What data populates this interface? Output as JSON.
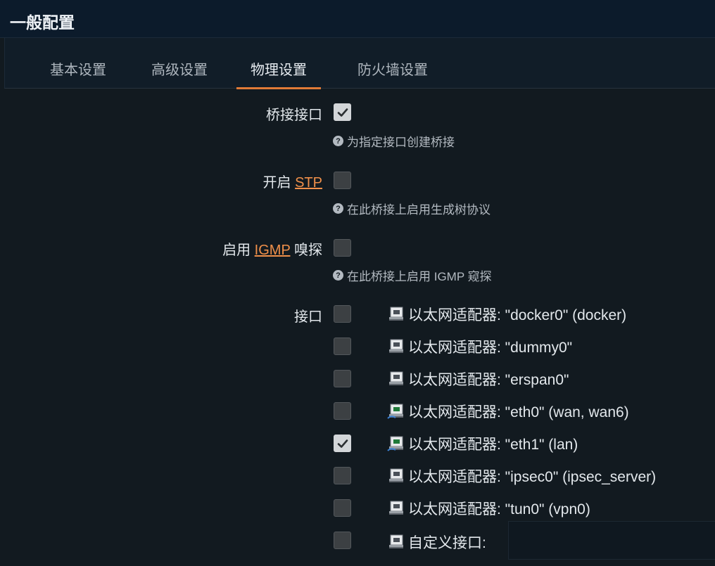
{
  "header": {
    "title": "一般配置"
  },
  "tabs": [
    {
      "label": "基本设置",
      "active": false
    },
    {
      "label": "高级设置",
      "active": false
    },
    {
      "label": "物理设置",
      "active": true
    },
    {
      "label": "防火墙设置",
      "active": false
    }
  ],
  "bridge": {
    "label": "桥接接口",
    "checked": true,
    "help": "为指定接口创建桥接"
  },
  "stp": {
    "label_prefix": "开启 ",
    "link": "STP",
    "checked": false,
    "help": "在此桥接上启用生成树协议"
  },
  "igmp": {
    "label_prefix": "启用 ",
    "link": "IGMP",
    "label_suffix": " 嗅探",
    "checked": false,
    "help": "在此桥接上启用 IGMP 窥探"
  },
  "interfaces": {
    "label": "接口",
    "items": [
      {
        "text": "以太网适配器: \"docker0\" (docker)",
        "checked": false,
        "icon": "ethernet-port-icon"
      },
      {
        "text": "以太网适配器: \"dummy0\"",
        "checked": false,
        "icon": "ethernet-port-icon"
      },
      {
        "text": "以太网适配器: \"erspan0\"",
        "checked": false,
        "icon": "ethernet-port-icon"
      },
      {
        "text": "以太网适配器: \"eth0\" (wan, wan6)",
        "checked": false,
        "icon": "ethernet-port-connected-icon"
      },
      {
        "text": "以太网适配器: \"eth1\" (lan)",
        "checked": true,
        "icon": "ethernet-port-connected-icon"
      },
      {
        "text": "以太网适配器: \"ipsec0\" (ipsec_server)",
        "checked": false,
        "icon": "ethernet-port-icon"
      },
      {
        "text": "以太网适配器: \"tun0\" (vpn0)",
        "checked": false,
        "icon": "ethernet-port-icon"
      }
    ],
    "custom": {
      "label": "自定义接口:",
      "checked": false,
      "value": ""
    }
  },
  "colors": {
    "accent": "#e07a37",
    "link": "#f0904a",
    "background": "#121a20",
    "header": "#0c1b2b"
  }
}
